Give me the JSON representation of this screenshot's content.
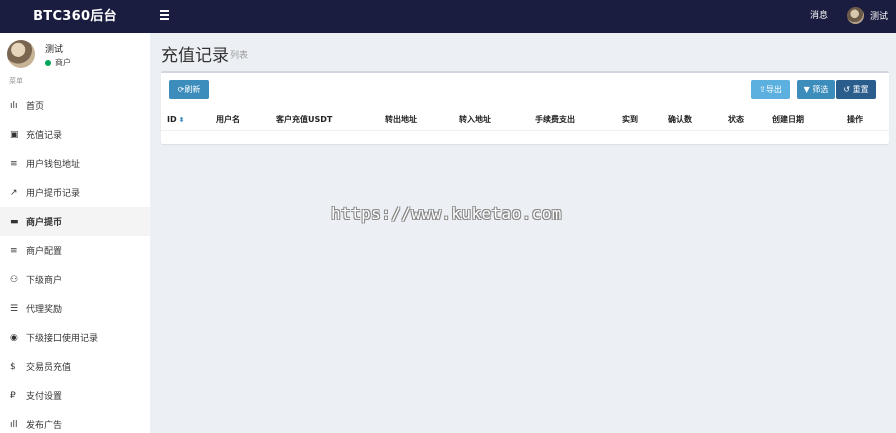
{
  "brand": "BTC360后台",
  "topbar": {
    "messages": "消息",
    "user_name": "测试"
  },
  "user_panel": {
    "name": "测试",
    "status": "商户"
  },
  "menu_header": "菜单",
  "menu": [
    {
      "label": "首页",
      "icon": "bar-chart-icon",
      "glyph": "ılı",
      "active": false
    },
    {
      "label": "充值记录",
      "icon": "document-icon",
      "glyph": "▣",
      "active": false
    },
    {
      "label": "用户钱包地址",
      "icon": "list-icon",
      "glyph": "≡",
      "active": false
    },
    {
      "label": "用户提币记录",
      "icon": "external-link-icon",
      "glyph": "↗",
      "active": false
    },
    {
      "label": "商户提币",
      "icon": "credit-card-icon",
      "glyph": "▬",
      "active": true
    },
    {
      "label": "商户配置",
      "icon": "list-icon",
      "glyph": "≡",
      "active": false
    },
    {
      "label": "下级商户",
      "icon": "user-plus-icon",
      "glyph": "⚇",
      "active": false
    },
    {
      "label": "代理奖励",
      "icon": "list-alt-icon",
      "glyph": "☰",
      "active": false
    },
    {
      "label": "下级接口使用记录",
      "icon": "circle-arrow-icon",
      "glyph": "◉",
      "active": false
    },
    {
      "label": "交易员充值",
      "icon": "dollar-icon",
      "glyph": "$",
      "active": false
    },
    {
      "label": "支付设置",
      "icon": "paypal-icon",
      "glyph": "₽",
      "active": false
    },
    {
      "label": "发布广告",
      "icon": "signal-icon",
      "glyph": "ıll",
      "active": false
    }
  ],
  "page": {
    "title": "充值记录",
    "subtitle": "列表"
  },
  "toolbar": {
    "refresh": "⟳刷新",
    "export": "⇪导出",
    "filter": "▼ 筛选",
    "reset": "↺ 重置"
  },
  "table": {
    "columns": [
      "ID",
      "用户名",
      "客户充值USDT",
      "转出地址",
      "转入地址",
      "手续费支出",
      "实到",
      "确认数",
      "状态",
      "创建日期",
      "操作"
    ],
    "rows": []
  },
  "watermark": "https://www.kuketao.com",
  "colors": {
    "topbar": "#1a1d3f",
    "primary": "#3c8dbc",
    "online": "#00a65a"
  }
}
